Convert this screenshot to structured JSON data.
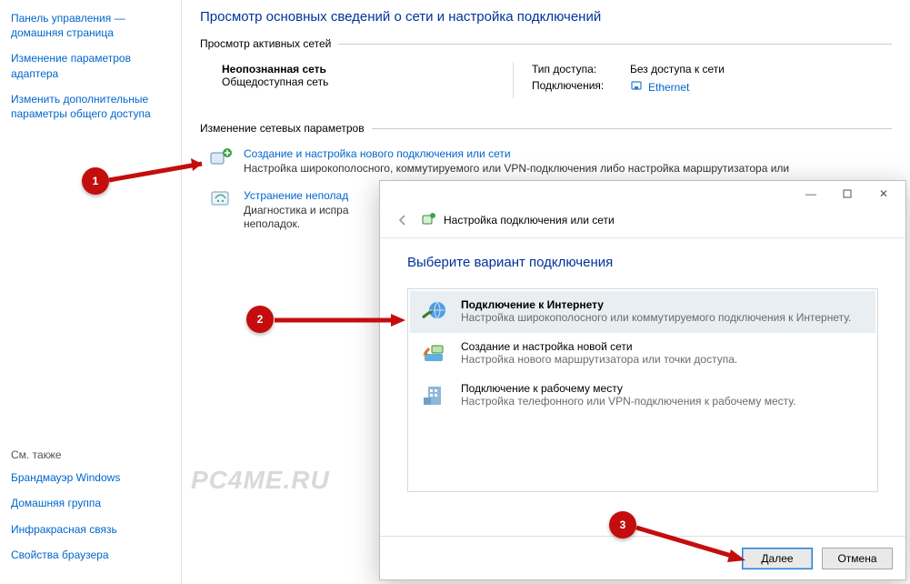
{
  "sidebar": {
    "items": [
      "Панель управления — домашняя страница",
      "Изменение параметров адаптера",
      "Изменить дополнительные параметры общего доступа"
    ],
    "see_also_heading": "См. также",
    "see_also": [
      "Брандмауэр Windows",
      "Домашняя группа",
      "Инфракрасная связь",
      "Свойства браузера"
    ]
  },
  "content": {
    "title": "Просмотр основных сведений о сети и настройка подключений",
    "active_networks_legend": "Просмотр активных сетей",
    "network": {
      "name": "Неопознанная сеть",
      "profile": "Общедоступная сеть",
      "access_label": "Тип доступа:",
      "access_value": "Без доступа к сети",
      "conn_label": "Подключения:",
      "conn_value": "Ethernet"
    },
    "settings_legend": "Изменение сетевых параметров",
    "tasks": [
      {
        "title": "Создание и настройка нового подключения или сети",
        "desc": "Настройка широкополосного, коммутируемого или VPN-подключения либо настройка маршрутизатора или"
      },
      {
        "title": "Устранение неполад",
        "desc": "Диагностика и испра\nнеполадок."
      }
    ]
  },
  "wizard": {
    "breadcrumb": "Настройка подключения или сети",
    "heading": "Выберите вариант подключения",
    "options": [
      {
        "title": "Подключение к Интернету",
        "desc": "Настройка широкополосного или коммутируемого подключения к Интернету."
      },
      {
        "title": "Создание и настройка новой сети",
        "desc": "Настройка нового маршрутизатора или точки доступа."
      },
      {
        "title": "Подключение к рабочему месту",
        "desc": "Настройка телефонного или VPN-подключения к рабочему месту."
      }
    ],
    "next": "Далее",
    "cancel": "Отмена"
  },
  "watermark": "PC4ME.RU",
  "badges": {
    "b1": "1",
    "b2": "2",
    "b3": "3"
  }
}
